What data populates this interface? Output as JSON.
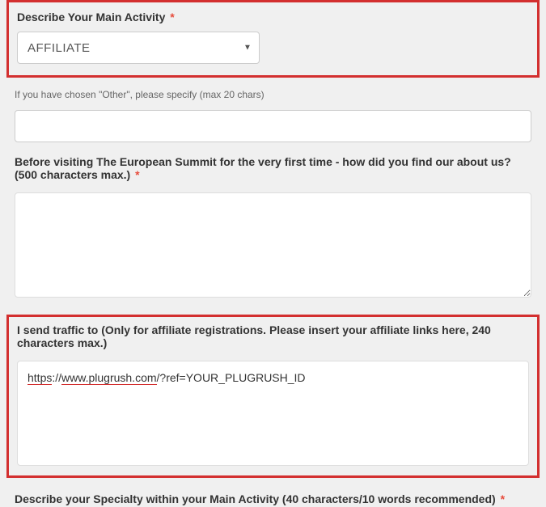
{
  "field_activity": {
    "label": "Describe Your Main Activity",
    "required": "*",
    "value": "AFFILIATE"
  },
  "field_other": {
    "label": "If you have chosen \"Other\", please specify (max 20 chars)",
    "value": ""
  },
  "field_findus": {
    "label": "Before visiting The European Summit for the very first time - how did you find our about us? (500 characters max.)",
    "required": "*",
    "value": ""
  },
  "field_traffic": {
    "label": "I send traffic to (Only for affiliate registrations. Please insert your affiliate links here, 240 characters max.)",
    "value_pre1": "https",
    "value_mid": "://",
    "value_pre2": "www.plugrush.com",
    "value_post": "/?ref=YOUR_PLUGRUSH_ID"
  },
  "field_specialty": {
    "label": "Describe your Specialty within your Main Activity (40 characters/10 words recommended)",
    "required": "*"
  }
}
